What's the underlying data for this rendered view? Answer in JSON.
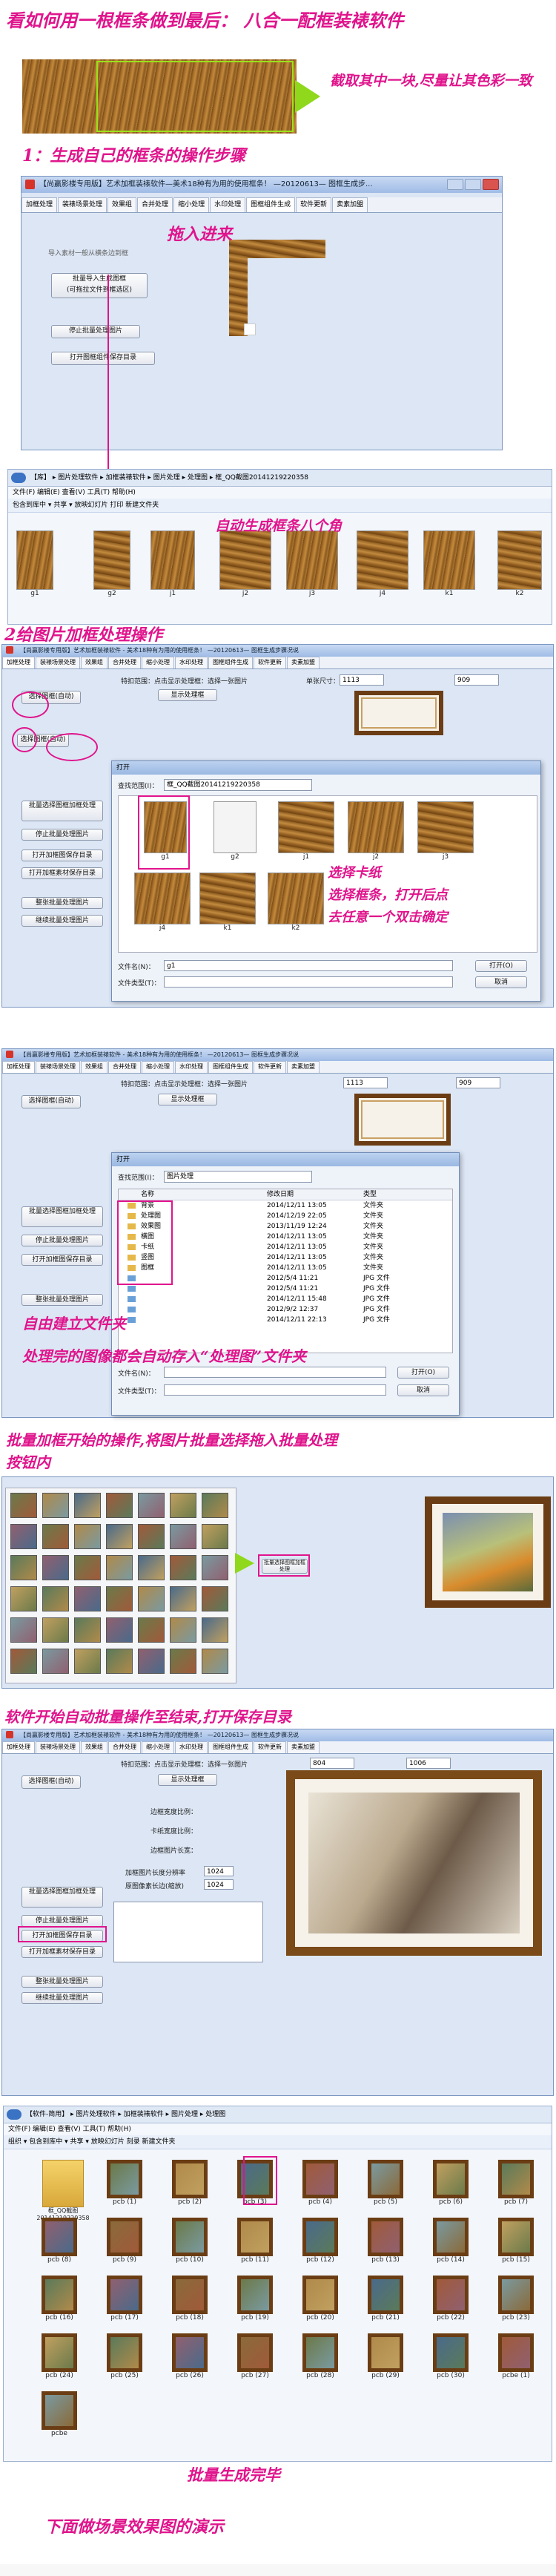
{
  "heading": "看如何用一根框条做到最后： 八合一配框装裱软件",
  "note_crop": "截取其中一块,尽量让其色彩一致",
  "step1": "1：生成自己的框条的操作步骤",
  "app": {
    "title1": "【尚赢影楼专用版】艺术加框装裱软件—美术18种有为用的使用框条！ —20120613—    图框生成步...",
    "title2": "【尚赢影楼专用版】艺术加框装裱软件 - 美术18种有为用的使用框条！ —20120613—        图框生成步骤况说",
    "tabs": [
      "加框处理",
      "装裱场景处理",
      "效果组",
      "合并处理",
      "缩小处理",
      "水印处理",
      "图框组件生成",
      "软件更新",
      "卖素加盟"
    ],
    "hint_import": "导入素材一般从横条边到框",
    "btn_batch_import": "批量导入生成图框\n(可拖拉文件到框选区)",
    "btn_stop": "停止批量处理图片",
    "btn_open_dir": "打开图框组件保存目录",
    "btn_show_handle": "显示处理框",
    "lbl_size": "单张尺寸：",
    "lbl_w": "1113",
    "lbl_h": "909",
    "lbl_select": "特扣范围：点击显示处理框：选择一张图片",
    "btn_single": "单张加框处理",
    "btn_select_frame": "选择图框(自动)",
    "btn_batch_frame": "批量选择图框加框处理",
    "btn_stop2": "停止批量处理图片",
    "btn_open_save": "打开加框图保存目录",
    "btn_open_frame": "打开加框素材保存目录",
    "btn_clear": "整张批量处理图片",
    "btn_continue": "继续批量处理图片",
    "lbl_frame_w": "边框宽度比例：",
    "lbl_card_w": "卡纸宽度比例：",
    "lbl_frame_size": "边框图片长宽：",
    "val_1024": "1024",
    "lbl_quality": "加框图片长度分辨率",
    "lbl_scale": "原图像素长边(缩放)"
  },
  "drag_in": "拖入进来",
  "explorer1": {
    "addr": "【库】 ▸ 图片处理软件 ▸ 加框装裱软件 ▸ 图片处理 ▸ 处理图 ▸ 框_QQ截图20141219220358",
    "menu": "文件(F)   编辑(E)   查看(V)   工具(T)   帮助(H)",
    "tool": "包含到库中 ▾      共享 ▾      放映幻灯片      打印      新建文件夹",
    "items": [
      "g1",
      "g2",
      "j1",
      "j2",
      "j3",
      "j4",
      "k1",
      "k2"
    ]
  },
  "auto_gen": "自动生成框条八个角",
  "step2": "2给图片加框处理操作",
  "dlg1": {
    "title": "打开",
    "lookin_label": "查找范围(I)：",
    "lookin": "框_QQ截图20141219220358",
    "items": [
      "g1",
      "g2",
      "j1",
      "j2",
      "j3",
      "j4",
      "k1",
      "k2"
    ],
    "file_label": "文件名(N)：",
    "file_val": "g1",
    "type_label": "文件类型(T)：",
    "open": "打开(O)",
    "cancel": "取消"
  },
  "select_note1": "选择卡纸",
  "select_note2": "选择框条，打开后点",
  "select_note3": "去任意一个双击确定",
  "dlg2": {
    "title": "打开",
    "lookin_label": "查找范围(I)：",
    "lookin": "图片处理",
    "col_name": "名称",
    "col_date": "修改日期",
    "col_type": "类型",
    "rows": [
      {
        "name": "背景",
        "date": "2014/12/11 13:05",
        "type": "文件夹"
      },
      {
        "name": "处理图",
        "date": "2014/12/19 22:05",
        "type": "文件夹"
      },
      {
        "name": "效果图",
        "date": "2013/11/19 12:24",
        "type": "文件夹"
      },
      {
        "name": "橫图",
        "date": "2014/12/11 13:05",
        "type": "文件夹"
      },
      {
        "name": "卡纸",
        "date": "2014/12/11 13:05",
        "type": "文件夹"
      },
      {
        "name": "竖图",
        "date": "2014/12/11 13:05",
        "type": "文件夹"
      },
      {
        "name": "图框",
        "date": "2014/12/11 13:05",
        "type": "文件夹"
      },
      {
        "name": "",
        "date": "2012/5/4 11:21",
        "type": "JPG 文件"
      },
      {
        "name": "",
        "date": "2012/5/4 11:21",
        "type": "JPG 文件"
      },
      {
        "name": "",
        "date": "2014/12/11 15:48",
        "type": "JPG 文件"
      },
      {
        "name": "",
        "date": "2012/9/2 12:37",
        "type": "JPG 文件"
      },
      {
        "name": "",
        "date": "2014/12/11 22:13",
        "type": "JPG 文件"
      }
    ],
    "file_label": "文件名(N)：",
    "type_label": "文件类型(T)：",
    "open": "打开(O)",
    "cancel": "取消"
  },
  "folder_note1": "自由建立文件夹",
  "folder_note2": "处理完的图像都会自动存入“处理图”文件夹",
  "step3": "批量加框开始的操作,将图片批量选择拖入批量处理",
  "step3b": "按钮内",
  "step4": "软件开始自动批量操作至结束,打开保存目录",
  "explorer2": {
    "addr": "【软件-简用】 ▸ 图片处理软件 ▸ 加框装裱软件 ▸ 图片处理 ▸ 处理图",
    "menu": "文件(F)   编辑(E)   查看(V)   工具(T)   帮助(H)",
    "tool": "组织 ▾     包含到库中 ▾     共享 ▾     放映幻灯片     刻录     新建文件夹",
    "first": "框_QQ截图\n20141219220358",
    "items": [
      "pcb (1)",
      "pcb (2)",
      "pcb (3)",
      "pcb (4)",
      "pcb (5)",
      "pcb (6)",
      "pcb (7)",
      "pcb (8)",
      "pcb (9)",
      "pcb (10)",
      "pcb (11)",
      "pcb (12)",
      "pcb (13)",
      "pcb (14)",
      "pcb (15)",
      "pcb (16)",
      "pcb (17)",
      "pcb (18)",
      "pcb (19)",
      "pcb (20)",
      "pcb (21)",
      "pcb (22)",
      "pcb (23)",
      "pcb (24)",
      "pcb (25)",
      "pcb (26)",
      "pcb (27)",
      "pcb (28)",
      "pcb (29)",
      "pcb (30)",
      "pcbe (1)",
      "pcbe"
    ]
  },
  "done": "批量生成完毕",
  "demo": "下面做场景效果图的演示",
  "colors": {
    "accent": "#e0148c",
    "wood": "#8a5a20"
  }
}
